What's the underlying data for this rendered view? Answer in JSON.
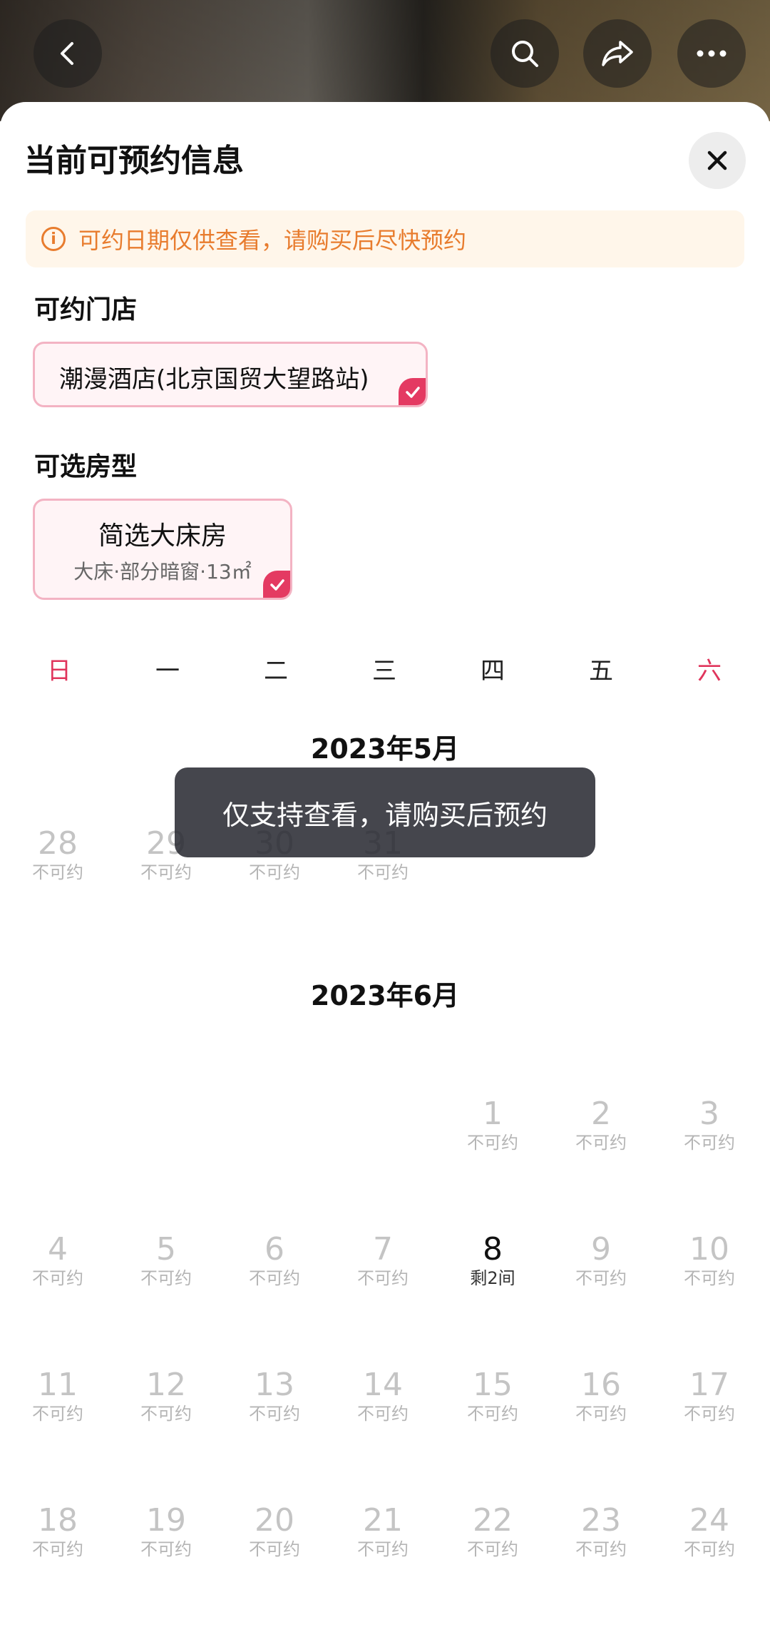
{
  "sheet": {
    "title": "当前可预约信息",
    "notice": "可约日期仅供查看，请购买后尽快预约",
    "store_label": "可约门店",
    "store_name": "潮漫酒店(北京国贸大望路站)",
    "room_label": "可选房型",
    "room_name": "简选大床房",
    "room_desc": "大床·部分暗窗·13㎡"
  },
  "weekdays": [
    "日",
    "一",
    "二",
    "三",
    "四",
    "五",
    "六"
  ],
  "months": [
    {
      "title": "2023年5月",
      "days": [
        {
          "d": "28",
          "s": "不可约"
        },
        {
          "d": "29",
          "s": "不可约"
        },
        {
          "d": "30",
          "s": "不可约"
        },
        {
          "d": "31",
          "s": "不可约"
        }
      ]
    },
    {
      "title": "2023年6月",
      "days": [
        {
          "d": "1",
          "s": "不可约"
        },
        {
          "d": "2",
          "s": "不可约"
        },
        {
          "d": "3",
          "s": "不可约"
        },
        {
          "d": "4",
          "s": "不可约"
        },
        {
          "d": "5",
          "s": "不可约"
        },
        {
          "d": "6",
          "s": "不可约"
        },
        {
          "d": "7",
          "s": "不可约"
        },
        {
          "d": "8",
          "s": "剩2间"
        },
        {
          "d": "9",
          "s": "不可约"
        },
        {
          "d": "10",
          "s": "不可约"
        },
        {
          "d": "11",
          "s": "不可约"
        },
        {
          "d": "12",
          "s": "不可约"
        },
        {
          "d": "13",
          "s": "不可约"
        },
        {
          "d": "14",
          "s": "不可约"
        },
        {
          "d": "15",
          "s": "不可约"
        },
        {
          "d": "16",
          "s": "不可约"
        },
        {
          "d": "17",
          "s": "不可约"
        },
        {
          "d": "18",
          "s": "不可约"
        },
        {
          "d": "19",
          "s": "不可约"
        },
        {
          "d": "20",
          "s": "不可约"
        },
        {
          "d": "21",
          "s": "不可约"
        },
        {
          "d": "22",
          "s": "不可约"
        },
        {
          "d": "23",
          "s": "不可约"
        },
        {
          "d": "24",
          "s": "不可约"
        }
      ]
    }
  ],
  "toast": "仅支持查看，请购买后预约",
  "colors": {
    "accent": "#e43a62",
    "notice_text": "#e87c2e",
    "notice_bg": "#fff6ea"
  },
  "icons": [
    "back-icon",
    "search-icon",
    "share-icon",
    "more-icon",
    "close-icon",
    "info-icon",
    "check-icon"
  ]
}
